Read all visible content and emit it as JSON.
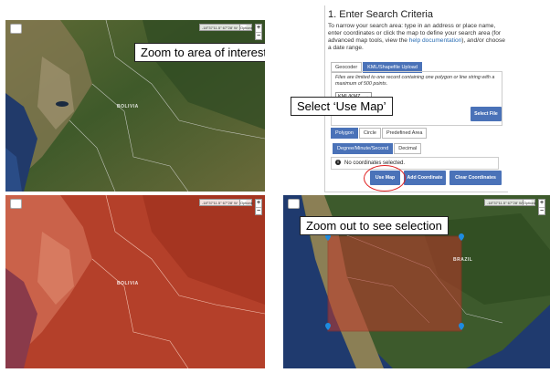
{
  "map_ui": {
    "coord_readout": "-18°37'11.5\" 67°28' W",
    "options_label": "Options",
    "zoom_in": "+",
    "zoom_out": "−"
  },
  "panels": {
    "zoom_in_map": {
      "callout": "Zoom to area of interest",
      "country_label": "BOLIVIA"
    },
    "selection_map": {
      "country_label": "BOLIVIA",
      "overlay_color": "#c0391f"
    },
    "zoom_out_map": {
      "callout": "Zoom out to see selection",
      "country_label": "BRAZIL",
      "selection_color": "#c0392b"
    }
  },
  "search_criteria": {
    "title": "1. Enter Search Criteria",
    "description": "To narrow your search area: type in an address or place name, enter coordinates or click the map to define your search area (for advanced map tools, view the",
    "help_link": "help documentation",
    "description_end": "), and/or choose a date range.",
    "tabs": [
      "Geocoder",
      "KML/Shapefile Upload"
    ],
    "active_tab": "KML/Shapefile Upload",
    "upload_note": "Files are limited to one record containing one polygon or line string with a maximum of 500 points.",
    "file_type": "KML/KMZ",
    "select_file_label": "Select File",
    "shape_tabs": [
      "Polygon",
      "Circle",
      "Predefined Area"
    ],
    "format_tabs": [
      "Degree/Minute/Second",
      "Decimal"
    ],
    "no_coords_text": "No coordinates selected.",
    "use_map_label": "Use Map",
    "add_coordinate_label": "Add Coordinate",
    "clear_coordinates_label": "Clear Coordinates",
    "callout": "Select ‘Use Map’"
  },
  "colors": {
    "accent_blue": "#4a72b8",
    "highlight_red": "#e02020"
  }
}
